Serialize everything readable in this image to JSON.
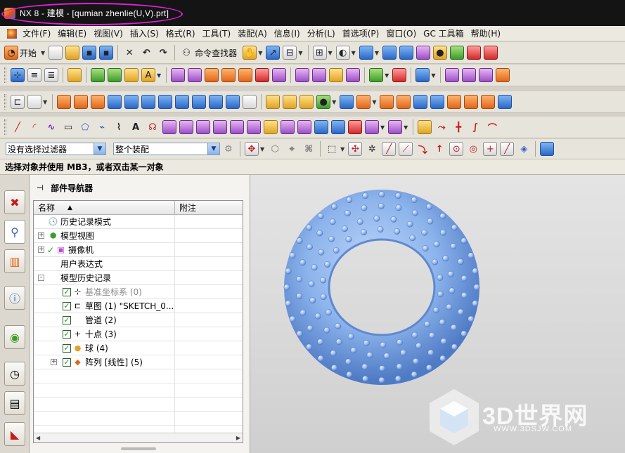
{
  "window": {
    "title": "NX 8 - 建模 - [qumian zhenlie(U,V).prt]"
  },
  "menu": [
    "文件(F)",
    "编辑(E)",
    "视图(V)",
    "插入(S)",
    "格式(R)",
    "工具(T)",
    "装配(A)",
    "信息(I)",
    "分析(L)",
    "首选项(P)",
    "窗口(O)",
    "GC 工具箱",
    "帮助(H)"
  ],
  "toolbar": {
    "start_label": "开始",
    "command_finder_label": "命令查找器"
  },
  "filter": {
    "type_filter": "没有选择过滤器",
    "scope": "整个装配"
  },
  "status": {
    "prompt": "选择对象并使用 MB3，或者双击某一对象"
  },
  "navigator": {
    "title": "部件导航器",
    "columns": {
      "name": "名称",
      "note": "附注"
    },
    "items": [
      {
        "label": "历史记录模式",
        "expand": "",
        "check": false
      },
      {
        "label": "模型视图",
        "expand": "+",
        "check": false
      },
      {
        "label": "摄像机",
        "expand": "+",
        "check": true
      },
      {
        "label": "用户表达式",
        "expand": "",
        "check": false
      },
      {
        "label": "模型历史记录",
        "expand": "-",
        "check": false
      },
      {
        "label": "基准坐标系 (0)",
        "expand": "",
        "check": true,
        "dim": true
      },
      {
        "label": "草图 (1) \"SKETCH_0...",
        "expand": "",
        "check": true
      },
      {
        "label": "管道 (2)",
        "expand": "",
        "check": true
      },
      {
        "label": "十点 (3)",
        "expand": "",
        "check": true
      },
      {
        "label": "球 (4)",
        "expand": "",
        "check": true
      },
      {
        "label": "阵列 [线性] (5)",
        "expand": "+",
        "check": true
      }
    ]
  },
  "watermark": {
    "brand": "3D世界网",
    "url": "WWW.3DSJW.COM"
  },
  "colors": {
    "accent_ring": "#e01fd8",
    "torus": "#8db4ec"
  }
}
